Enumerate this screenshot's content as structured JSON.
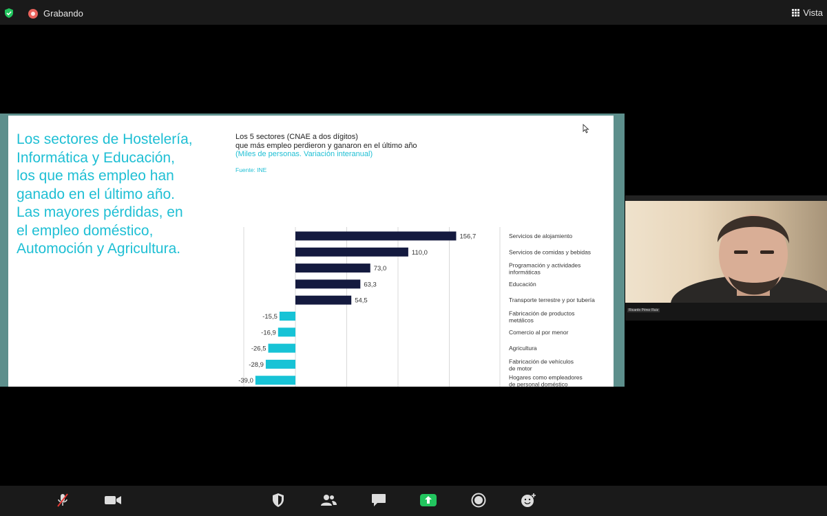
{
  "topbar": {
    "recording_label": "Grabando",
    "view_label": "Vista"
  },
  "slide": {
    "headline": "Los sectores de Hostelería, Informática y Educación, los que más empleo han ganado en el último año. Las mayores pérdidas, en el empleo doméstico, Automoción y Agricultura.",
    "chart_title_line1": "Los 5 sectores (CNAE a dos dígitos)",
    "chart_title_line2": "que más empleo perdieron y ganaron en el último año",
    "chart_subtitle": "(Miles de personas. Variación interanual)",
    "chart_source": "Fuente: INE"
  },
  "chart_data": {
    "type": "bar",
    "orientation": "horizontal",
    "categories": [
      "Servicios de alojamiento",
      "Servicios de comidas y bebidas",
      "Programación y actividades|informáticas",
      "Educación",
      "Transporte terrestre y por tubería",
      "Fabricación de productos|metálicos",
      "Comercio al por menor",
      "Agricultura",
      "Fabricación de vehículos|de motor",
      "Hogares como empleadores|de personal doméstico"
    ],
    "values": [
      156.7,
      110.0,
      73.0,
      63.3,
      54.5,
      -15.5,
      -16.9,
      -26.5,
      -28.9,
      -39.0
    ],
    "value_labels": [
      "156,7",
      "110,0",
      "73,0",
      "63,3",
      "54,5",
      "-15,5",
      "-16,9",
      "-26,5",
      "-28,9",
      "-39,0"
    ],
    "colors": {
      "positive": "#141a3f",
      "negative": "#17c3d6"
    },
    "grid": true
  },
  "video": {
    "participant_name": "Ricardo Pérez Ruiz"
  },
  "toolbar": {
    "mute": "microphone-muted-icon",
    "video": "video-camera-icon",
    "security": "shield-icon",
    "participants": "participants-icon",
    "chat": "chat-icon",
    "share": "share-screen-icon",
    "record": "record-icon",
    "reactions": "reactions-icon"
  }
}
